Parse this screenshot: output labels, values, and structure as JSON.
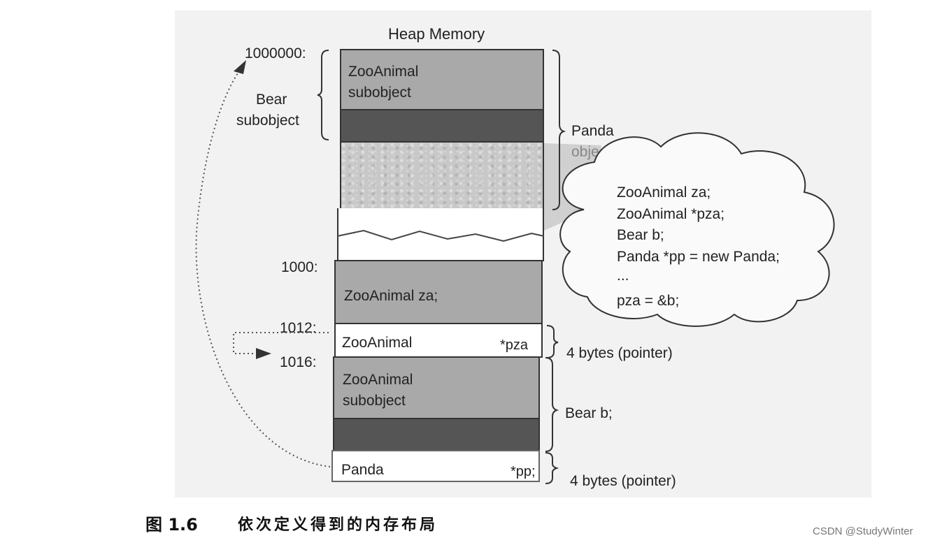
{
  "diagram": {
    "title": "Heap Memory",
    "addresses": {
      "a1000000": "1000000:",
      "a1000": "1000:",
      "a1012": "1012:",
      "a1016": "1016:"
    },
    "bear_subobject_label": [
      "Bear",
      "subobject"
    ],
    "panda_object_label": [
      "Panda",
      "object"
    ],
    "zooanimal_subobject_top": [
      "ZooAnimal",
      "subobject"
    ],
    "zooanimal_za_cell": "ZooAnimal za;",
    "pointer_cell": {
      "type": "ZooAnimal",
      "name": "*pza"
    },
    "zooanimal_subobject_bottom": [
      "ZooAnimal",
      "subobject"
    ],
    "panda_cell": {
      "type": "Panda",
      "name": "*pp;"
    },
    "right_labels": {
      "pza_size": "4 bytes (pointer)",
      "bear_b": "Bear b;",
      "pp_size": "4 bytes (pointer)"
    },
    "cloud_code": [
      "ZooAnimal za;",
      "ZooAnimal *pza;",
      "Bear b;",
      "Panda *pp = new Panda;",
      "...",
      "pza = &b;"
    ]
  },
  "caption": {
    "figure": "图 1.6",
    "text": "依次定义得到的内存布局"
  },
  "watermark": "CSDN @StudyWinter"
}
